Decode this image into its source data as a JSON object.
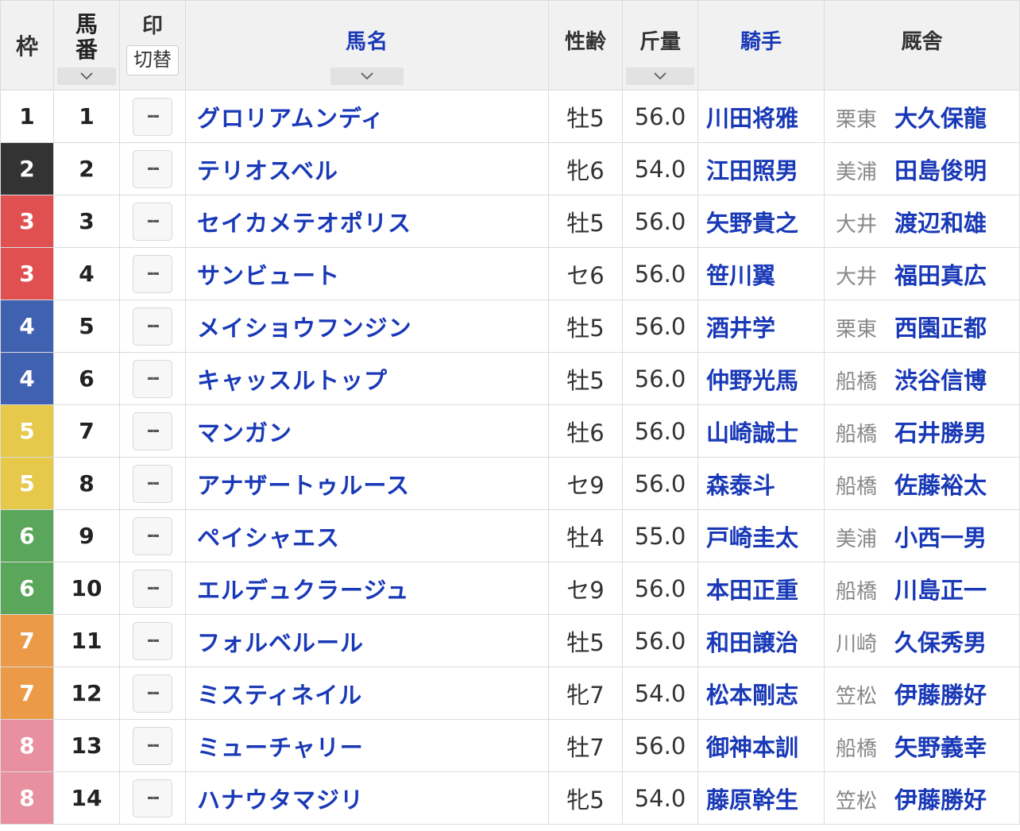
{
  "headers": {
    "waku": "枠",
    "umaban_line1": "馬",
    "umaban_line2": "番",
    "mark": "印",
    "mark_toggle": "切替",
    "name": "馬名",
    "sex_age": "性齢",
    "weight": "斤量",
    "jockey": "騎手",
    "trainer": "厩舎"
  },
  "mark_placeholder": "--",
  "colors": {
    "waku1": "#ffffff",
    "waku2": "#333333",
    "waku3": "#e05050",
    "waku4": "#4060b0",
    "waku5": "#e6c84a",
    "waku6": "#5aa65a",
    "waku7": "#eb9a48",
    "waku8": "#e890a0",
    "link": "#1939b7"
  },
  "rows": [
    {
      "waku": "1",
      "umaban": "1",
      "name": "グロリアムンディ",
      "sex_age": "牡5",
      "weight": "56.0",
      "jockey": "川田将雅",
      "area": "栗東",
      "trainer": "大久保龍"
    },
    {
      "waku": "2",
      "umaban": "2",
      "name": "テリオスベル",
      "sex_age": "牝6",
      "weight": "54.0",
      "jockey": "江田照男",
      "area": "美浦",
      "trainer": "田島俊明"
    },
    {
      "waku": "3",
      "umaban": "3",
      "name": "セイカメテオポリス",
      "sex_age": "牡5",
      "weight": "56.0",
      "jockey": "矢野貴之",
      "area": "大井",
      "trainer": "渡辺和雄"
    },
    {
      "waku": "3",
      "umaban": "4",
      "name": "サンビュート",
      "sex_age": "セ6",
      "weight": "56.0",
      "jockey": "笹川翼",
      "area": "大井",
      "trainer": "福田真広"
    },
    {
      "waku": "4",
      "umaban": "5",
      "name": "メイショウフンジン",
      "sex_age": "牡5",
      "weight": "56.0",
      "jockey": "酒井学",
      "area": "栗東",
      "trainer": "西園正都"
    },
    {
      "waku": "4",
      "umaban": "6",
      "name": "キャッスルトップ",
      "sex_age": "牡5",
      "weight": "56.0",
      "jockey": "仲野光馬",
      "area": "船橋",
      "trainer": "渋谷信博"
    },
    {
      "waku": "5",
      "umaban": "7",
      "name": "マンガン",
      "sex_age": "牡6",
      "weight": "56.0",
      "jockey": "山崎誠士",
      "area": "船橋",
      "trainer": "石井勝男"
    },
    {
      "waku": "5",
      "umaban": "8",
      "name": "アナザートゥルース",
      "sex_age": "セ9",
      "weight": "56.0",
      "jockey": "森泰斗",
      "area": "船橋",
      "trainer": "佐藤裕太"
    },
    {
      "waku": "6",
      "umaban": "9",
      "name": "ペイシャエス",
      "sex_age": "牡4",
      "weight": "55.0",
      "jockey": "戸崎圭太",
      "area": "美浦",
      "trainer": "小西一男"
    },
    {
      "waku": "6",
      "umaban": "10",
      "name": "エルデュクラージュ",
      "sex_age": "セ9",
      "weight": "56.0",
      "jockey": "本田正重",
      "area": "船橋",
      "trainer": "川島正一"
    },
    {
      "waku": "7",
      "umaban": "11",
      "name": "フォルベルール",
      "sex_age": "牡5",
      "weight": "56.0",
      "jockey": "和田譲治",
      "area": "川崎",
      "trainer": "久保秀男"
    },
    {
      "waku": "7",
      "umaban": "12",
      "name": "ミスティネイル",
      "sex_age": "牝7",
      "weight": "54.0",
      "jockey": "松本剛志",
      "area": "笠松",
      "trainer": "伊藤勝好"
    },
    {
      "waku": "8",
      "umaban": "13",
      "name": "ミューチャリー",
      "sex_age": "牡7",
      "weight": "56.0",
      "jockey": "御神本訓",
      "area": "船橋",
      "trainer": "矢野義幸"
    },
    {
      "waku": "8",
      "umaban": "14",
      "name": "ハナウタマジリ",
      "sex_age": "牝5",
      "weight": "54.0",
      "jockey": "藤原幹生",
      "area": "笠松",
      "trainer": "伊藤勝好"
    }
  ]
}
